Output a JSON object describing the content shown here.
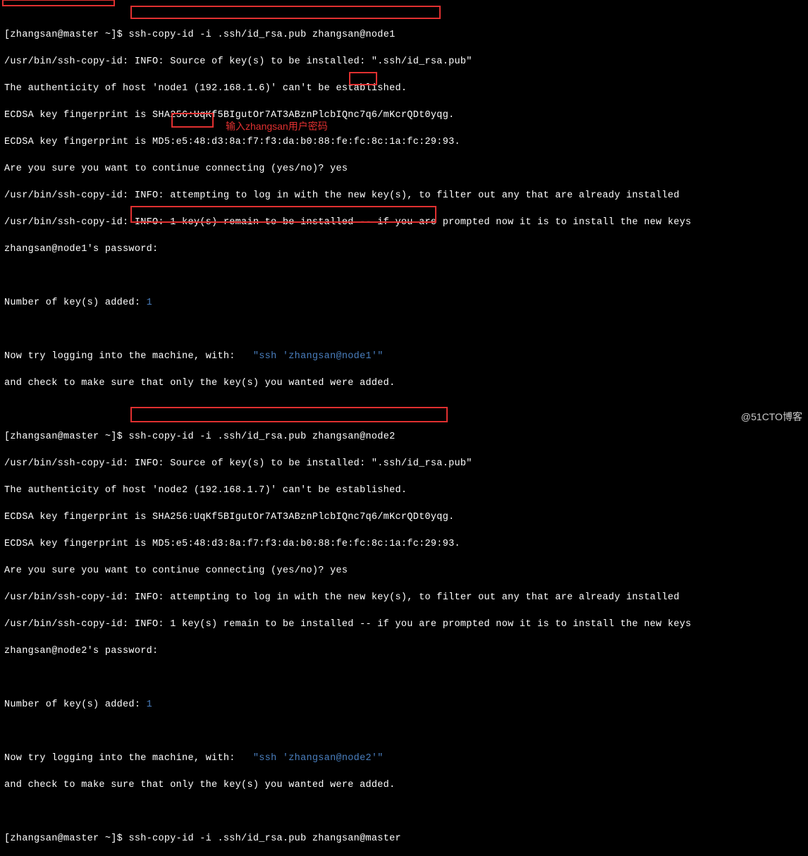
{
  "lines": {
    "l0a": "[zhangsan@master ~]$ ",
    "l0b": "ssh-copy-id -i .ssh/id_rsa.pub zhangsan@node1",
    "l1": "/usr/bin/ssh-copy-id: INFO: Source of key(s) to be installed: \".ssh/id_rsa.pub\"",
    "l2": "The authenticity of host 'node1 (192.168.1.6)' can't be established.",
    "l3": "ECDSA key fingerprint is SHA256:UqKf5BIgutOr7AT3ABznPlcbIQnc7q6/mKcrQDt0yqg.",
    "l4": "ECDSA key fingerprint is MD5:e5:48:d3:8a:f7:f3:da:b0:88:fe:fc:8c:1a:fc:29:93.",
    "l5": "Are you sure you want to continue connecting (yes/no)? yes",
    "l6": "/usr/bin/ssh-copy-id: INFO: attempting to log in with the new key(s), to filter out any that are already installed",
    "l7": "/usr/bin/ssh-copy-id: INFO: 1 key(s) remain to be installed -- if you are prompted now it is to install the new keys",
    "l8": "zhangsan@node1's password: ",
    "l9a": "Number of key(s) added: ",
    "l9b": "1",
    "l10a": "Now try logging into the machine, with:   ",
    "l10b": "\"ssh 'zhangsan@node1'\"",
    "l11": "and check to make sure that only the key(s) you wanted were added.",
    "l12a": "[zhangsan@master ~]$ ",
    "l12b": "ssh-copy-id -i .ssh/id_rsa.pub zhangsan@node2",
    "l13": "/usr/bin/ssh-copy-id: INFO: Source of key(s) to be installed: \".ssh/id_rsa.pub\"",
    "l14": "The authenticity of host 'node2 (192.168.1.7)' can't be established.",
    "l15": "ECDSA key fingerprint is SHA256:UqKf5BIgutOr7AT3ABznPlcbIQnc7q6/mKcrQDt0yqg.",
    "l16": "ECDSA key fingerprint is MD5:e5:48:d3:8a:f7:f3:da:b0:88:fe:fc:8c:1a:fc:29:93.",
    "l17": "Are you sure you want to continue connecting (yes/no)? yes",
    "l18": "/usr/bin/ssh-copy-id: INFO: attempting to log in with the new key(s), to filter out any that are already installed",
    "l19": "/usr/bin/ssh-copy-id: INFO: 1 key(s) remain to be installed -- if you are prompted now it is to install the new keys",
    "l20": "zhangsan@node2's password: ",
    "l21a": "Number of key(s) added: ",
    "l21b": "1",
    "l22a": "Now try logging into the machine, with:   ",
    "l22b": "\"ssh 'zhangsan@node2'\"",
    "l23": "and check to make sure that only the key(s) you wanted were added.",
    "l24a": "[zhangsan@master ~]$ ",
    "l24b": "ssh-copy-id -i .ssh/id_rsa.pub zhangsan@master"
  },
  "annotation": "输入zhangsan用户密码",
  "watermark": "@51CTO博客"
}
